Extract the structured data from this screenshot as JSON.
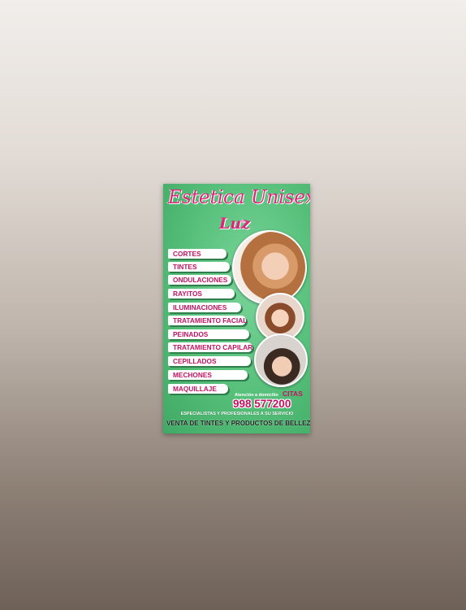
{
  "flyer": {
    "title": "Estetica Unisex",
    "subtitle": "Luz",
    "services": [
      "CORTES",
      "TINTES",
      "ONDULACIONES",
      "RAYITOS",
      "ILUMINACIONES",
      "TRATAMIENTO FACIAL",
      "PEINADOS",
      "TRATAMIENTO CAPILAR",
      "CEPILLADOS",
      "MECHONES",
      "MAQUILLAJE"
    ],
    "cta_small": "Atención a domicilio",
    "cta_label": "CITAS",
    "phone": "998 577200",
    "tagline": "ESPECIALISTAS Y PROFESIONALES A SU SERVICIO",
    "footer": "VENTA DE TINTES Y PRODUCTOS DE BELLEZA"
  },
  "colors": {
    "background": "#55bf79",
    "accent": "#e2217a",
    "pill_text": "#c21363"
  }
}
